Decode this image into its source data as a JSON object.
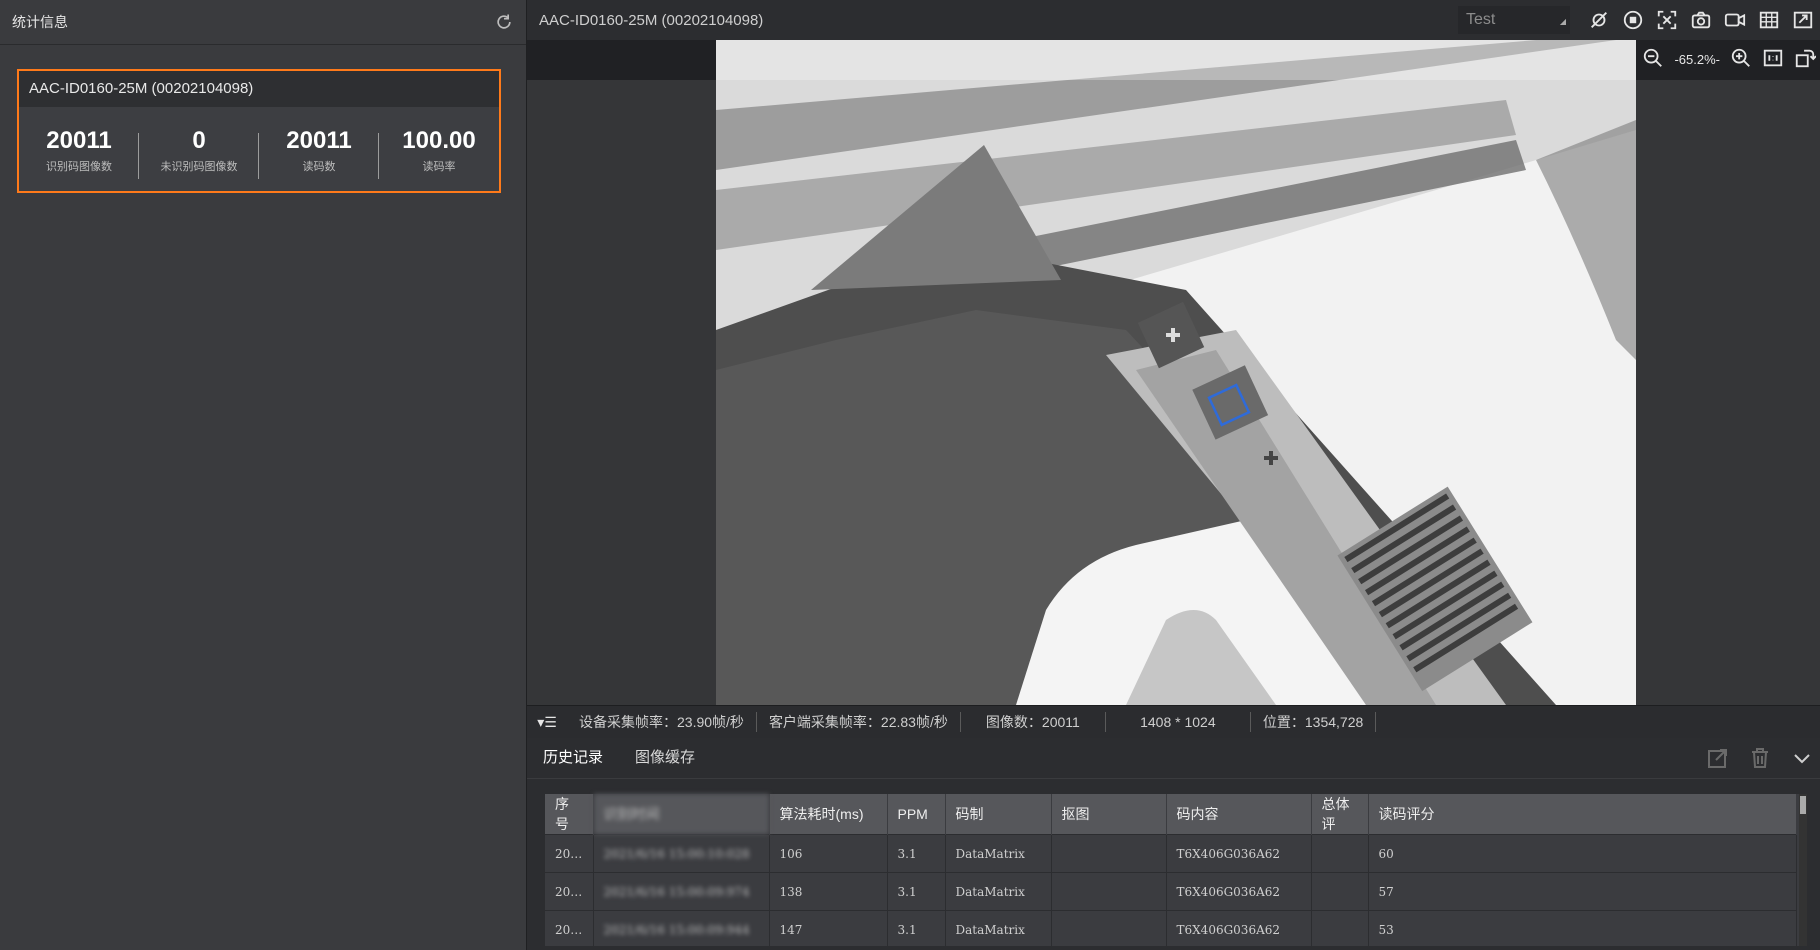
{
  "left_panel": {
    "title": "统计信息",
    "card": {
      "title": "AAC-ID0160-25M (00202104098)",
      "stats": [
        {
          "value": "20011",
          "label": "识别码图像数"
        },
        {
          "value": "0",
          "label": "未识别码图像数"
        },
        {
          "value": "20011",
          "label": "读码数"
        },
        {
          "value": "100.00",
          "label": "读码率"
        }
      ]
    }
  },
  "viewer": {
    "device_title": "AAC-ID0160-25M (00202104098)",
    "mode": "Test",
    "zoom": "-65.2%-",
    "toolbar_icons": [
      "no-trigger-icon",
      "stop-icon",
      "fullscreen-icon",
      "snapshot-icon",
      "record-icon",
      "grid-icon",
      "export-icon"
    ]
  },
  "status": {
    "device_fps": "设备采集帧率：23.90帧/秒",
    "client_fps": "客户端采集帧率：22.83帧/秒",
    "image_count": "图像数：20011",
    "resolution": "1408 * 1024",
    "position": "位置：1354,728"
  },
  "bottom": {
    "tabs": [
      "历史记录",
      "图像缓存"
    ],
    "table": {
      "headers": [
        "序号",
        "识别时间",
        "算法耗时(ms)",
        "PPM",
        "码制",
        "抠图",
        "码内容",
        "总体评",
        "读码评分"
      ],
      "rows": [
        [
          "20…",
          "2021/6/16 15:00:10:028",
          "106",
          "3.1",
          "DataMatrix",
          "",
          "T6X406G036A62",
          "",
          "60"
        ],
        [
          "20…",
          "2021/6/16 15:00:09:974",
          "138",
          "3.1",
          "DataMatrix",
          "",
          "T6X406G036A62",
          "",
          "57"
        ],
        [
          "20…",
          "2021/6/16 15:00:09:944",
          "147",
          "3.1",
          "DataMatrix",
          "",
          "T6X406G036A62",
          "",
          "53"
        ]
      ]
    }
  }
}
